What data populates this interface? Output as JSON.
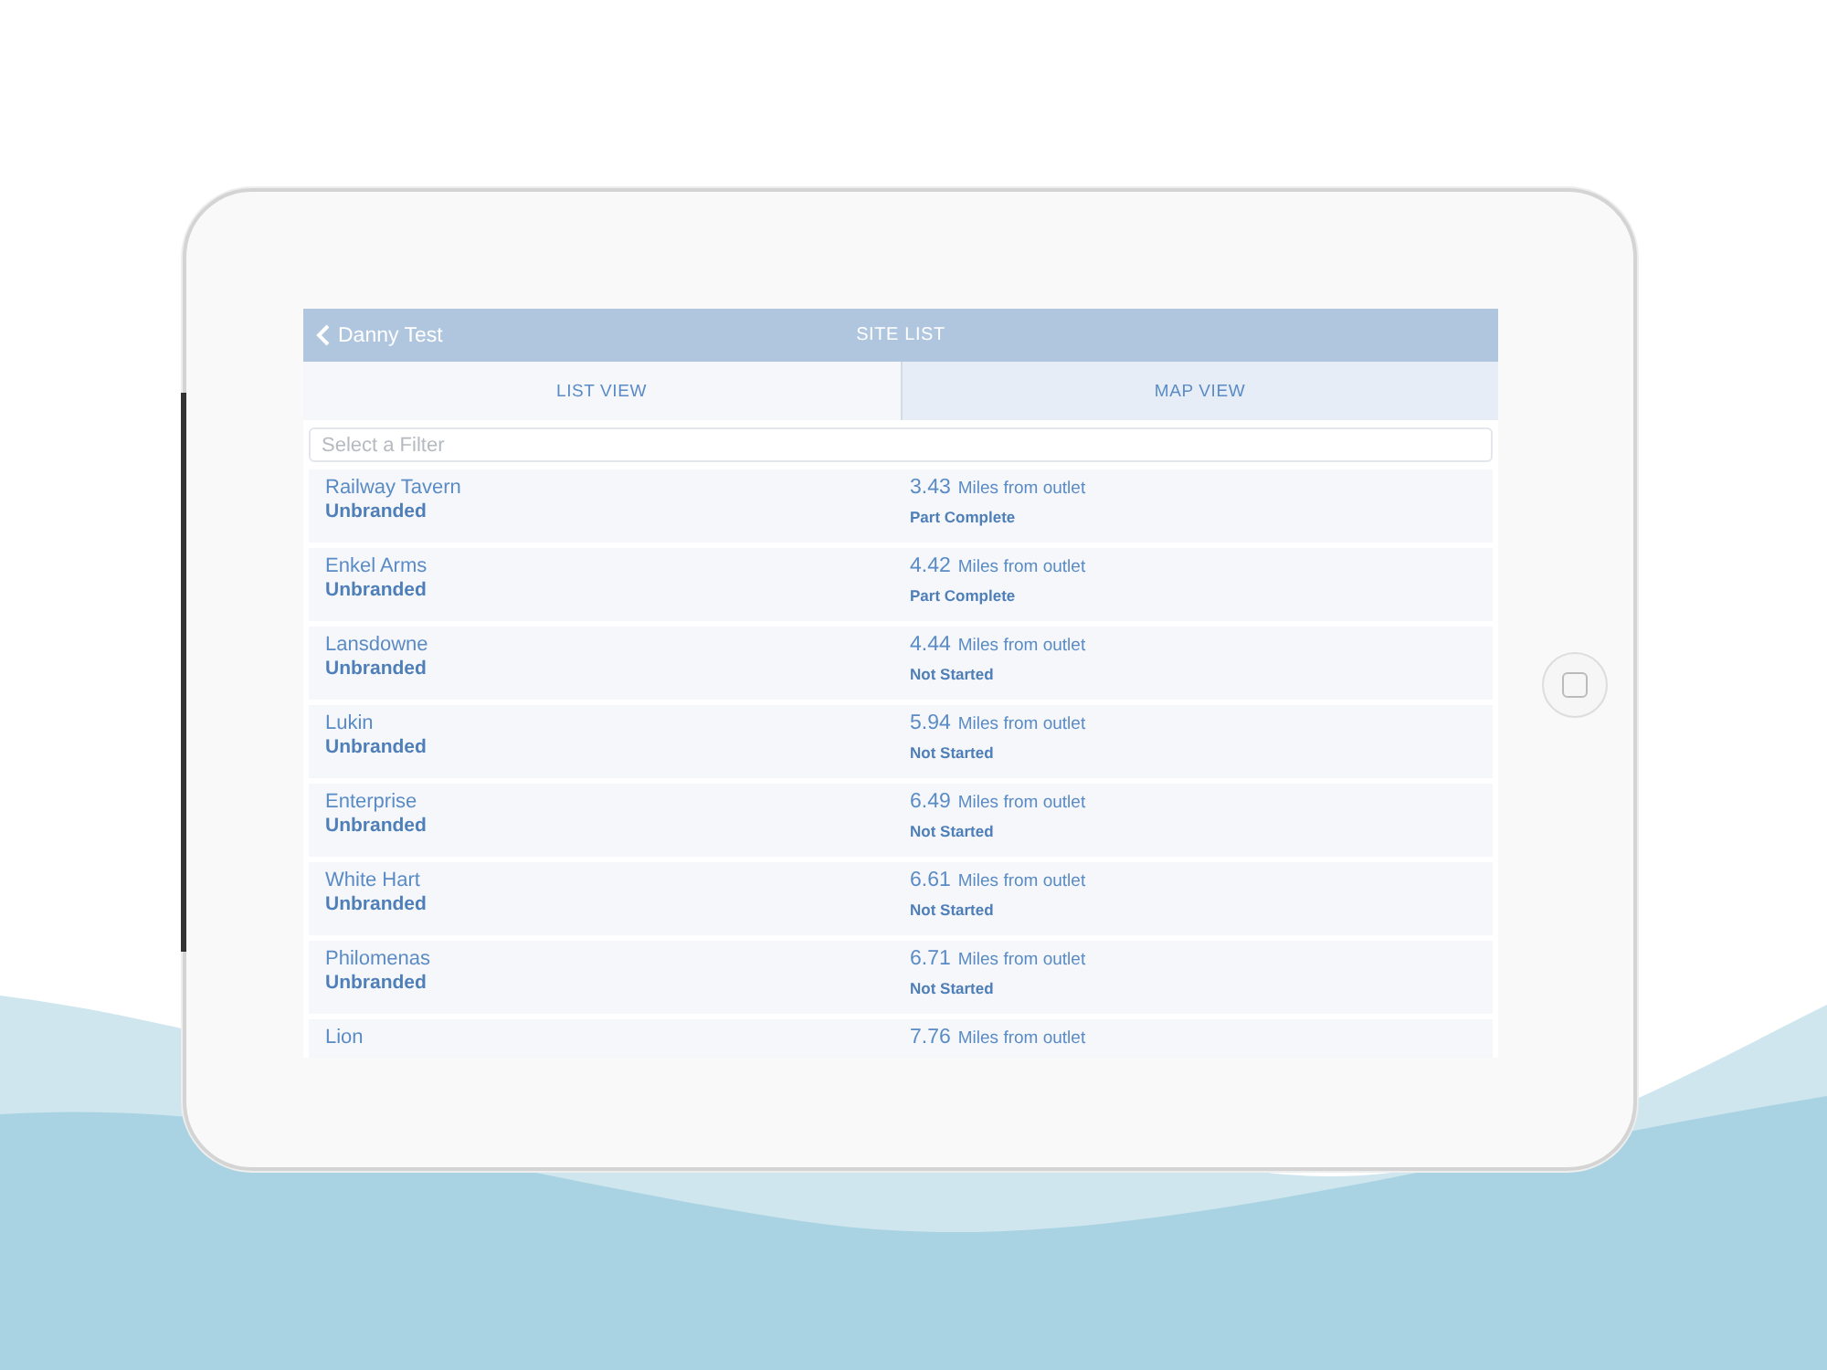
{
  "header": {
    "back_label": "Danny Test",
    "title": "SITE LIST"
  },
  "tabs": [
    {
      "label": "LIST VIEW",
      "selected": true
    },
    {
      "label": "MAP VIEW",
      "selected": false
    }
  ],
  "filter": {
    "placeholder": "Select a Filter"
  },
  "sites": [
    {
      "name": "Railway Tavern",
      "brand": "Unbranded",
      "distance": "3.43",
      "unit": "Miles from outlet",
      "status": "Part Complete"
    },
    {
      "name": "Enkel Arms",
      "brand": "Unbranded",
      "distance": "4.42",
      "unit": "Miles from outlet",
      "status": "Part Complete"
    },
    {
      "name": "Lansdowne",
      "brand": "Unbranded",
      "distance": "4.44",
      "unit": "Miles from outlet",
      "status": "Not Started"
    },
    {
      "name": "Lukin",
      "brand": "Unbranded",
      "distance": "5.94",
      "unit": "Miles from outlet",
      "status": "Not Started"
    },
    {
      "name": "Enterprise",
      "brand": "Unbranded",
      "distance": "6.49",
      "unit": "Miles from outlet",
      "status": "Not Started"
    },
    {
      "name": "White Hart",
      "brand": "Unbranded",
      "distance": "6.61",
      "unit": "Miles from outlet",
      "status": "Not Started"
    },
    {
      "name": "Philomenas",
      "brand": "Unbranded",
      "distance": "6.71",
      "unit": "Miles from outlet",
      "status": "Not Started"
    },
    {
      "name": "Lion",
      "distance": "7.76",
      "unit": "Miles from outlet"
    }
  ]
}
